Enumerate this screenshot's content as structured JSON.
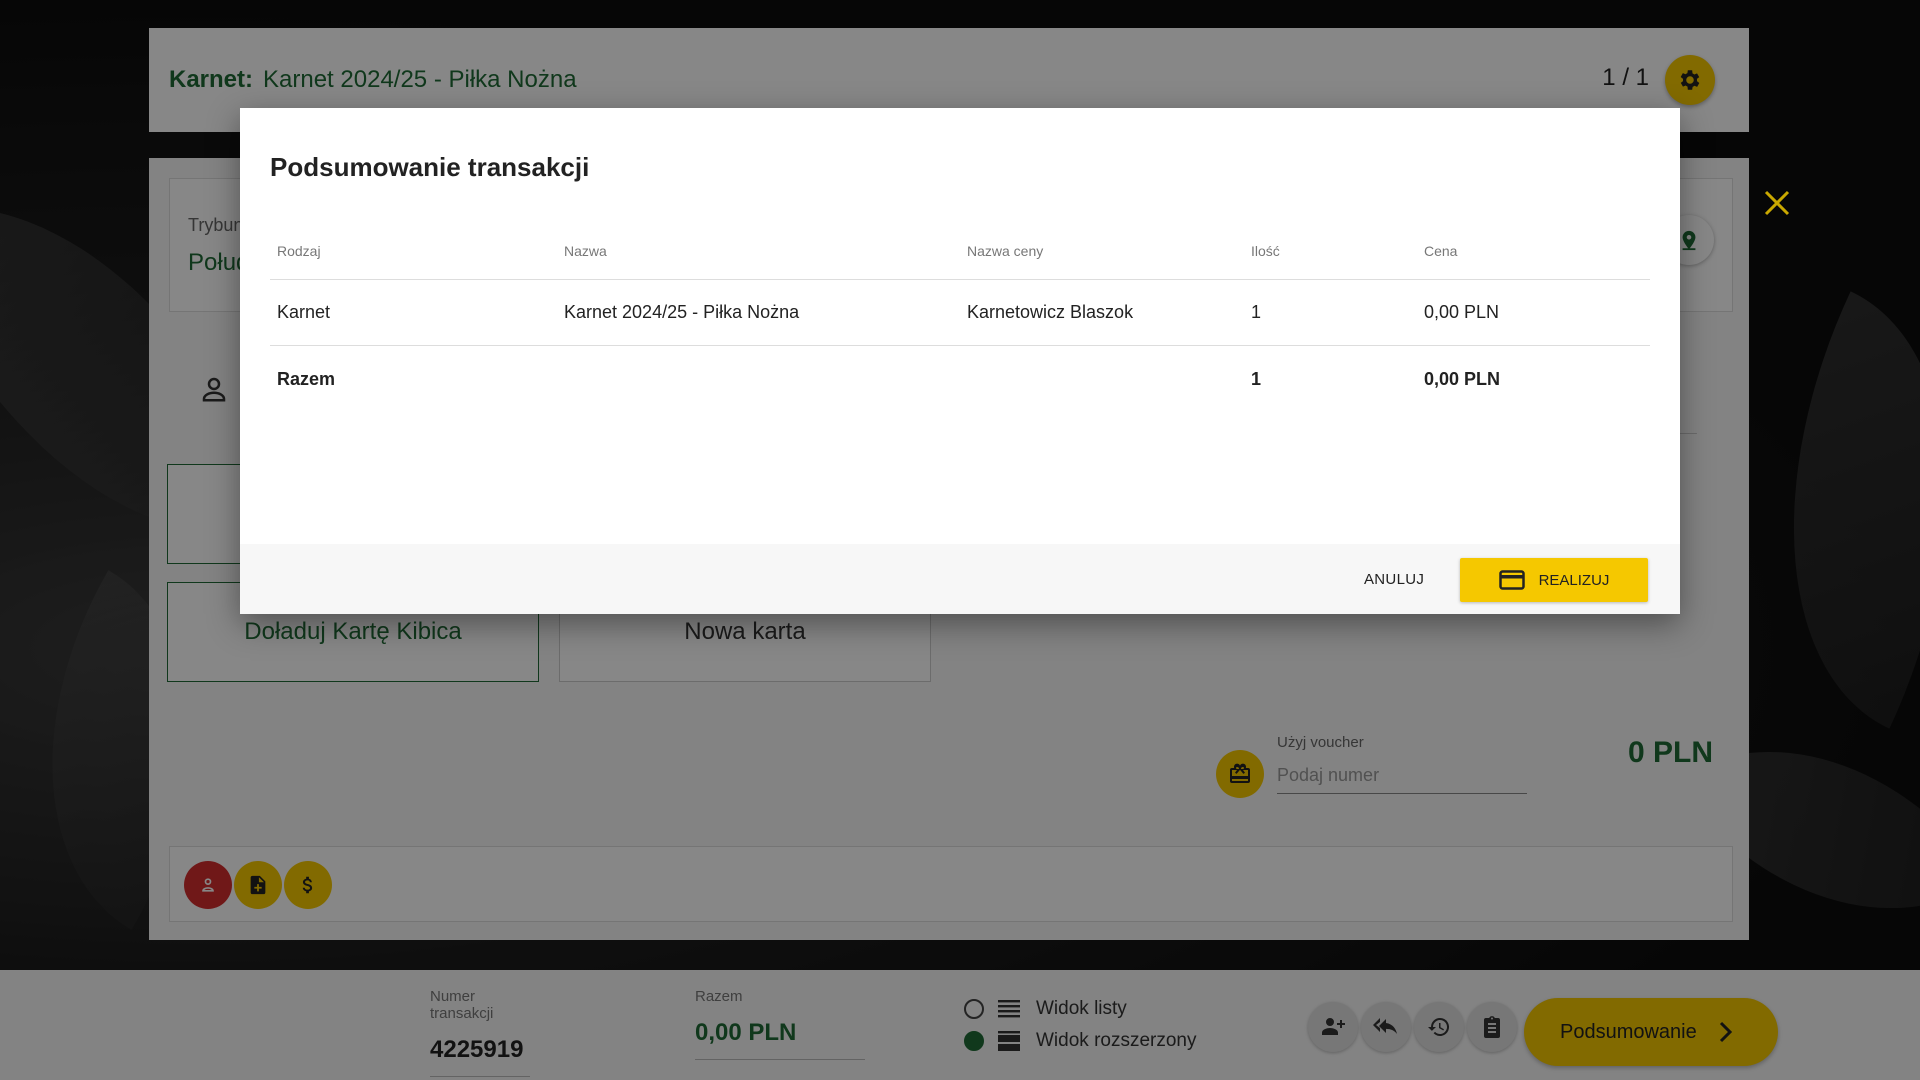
{
  "header": {
    "label": "Karnet:",
    "value": "Karnet 2024/25 - Piłka Nożna",
    "pager": "1 / 1"
  },
  "sector": {
    "label": "Trybuna",
    "value": "Połud"
  },
  "tiles": {
    "top_up": "Doładuj Kartę Kibica",
    "new_card": "Nowa karta"
  },
  "voucher": {
    "label": "Użyj voucher",
    "placeholder": "Podaj numer"
  },
  "panel_total": "0 PLN",
  "bottom": {
    "transaction_label": "Numer transakcji",
    "transaction_value": "4225919",
    "total_label": "Razem",
    "total_value": "0,00 PLN",
    "view_list": "Widok listy",
    "view_extended": "Widok rozszerzony",
    "summary_button": "Podsumowanie"
  },
  "modal": {
    "title": "Podsumowanie transakcji",
    "columns": [
      "Rodzaj",
      "Nazwa",
      "Nazwa ceny",
      "Ilość",
      "Cena"
    ],
    "rows": [
      [
        "Karnet",
        "Karnet 2024/25 - Piłka Nożna",
        "Karnetowicz Blaszok",
        "1",
        "0,00 PLN"
      ]
    ],
    "total": {
      "label": "Razem",
      "qty": "1",
      "price": "0,00 PLN"
    },
    "cancel": "ANULUJ",
    "confirm": "REALIZUJ"
  },
  "colors": {
    "accent_yellow": "#f5c800",
    "brand_green": "#1f6b35",
    "danger_red": "#d32f2f"
  },
  "icons": [
    "gear-icon",
    "map-pin-icon",
    "person-icon",
    "gift-card-icon",
    "person-remove-icon",
    "add-document-icon",
    "dollar-icon",
    "add-person-icon",
    "reply-all-icon",
    "history-icon",
    "clipboard-icon",
    "chevron-right-icon",
    "close-icon",
    "credit-card-icon",
    "list-view-icon",
    "extended-view-icon"
  ]
}
